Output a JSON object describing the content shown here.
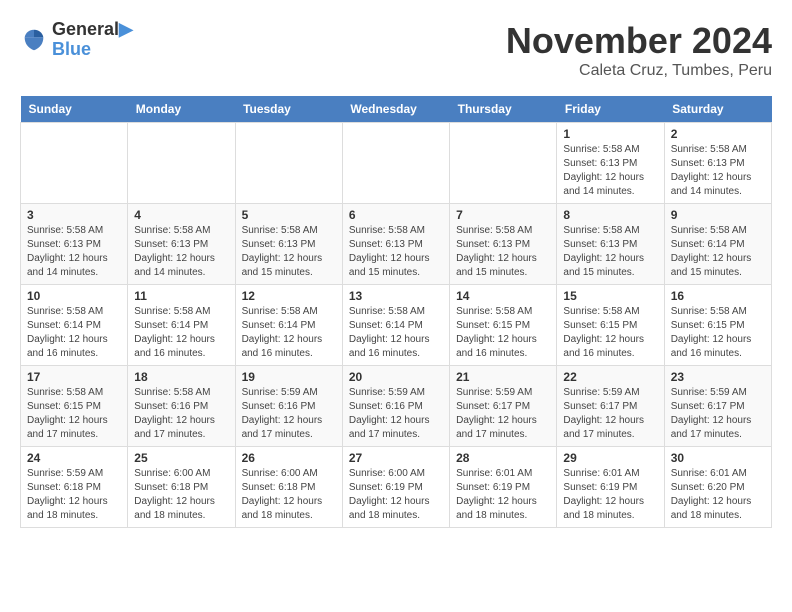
{
  "header": {
    "logo_line1": "General",
    "logo_line2": "Blue",
    "month": "November 2024",
    "location": "Caleta Cruz, Tumbes, Peru"
  },
  "weekdays": [
    "Sunday",
    "Monday",
    "Tuesday",
    "Wednesday",
    "Thursday",
    "Friday",
    "Saturday"
  ],
  "weeks": [
    [
      {
        "day": "",
        "info": ""
      },
      {
        "day": "",
        "info": ""
      },
      {
        "day": "",
        "info": ""
      },
      {
        "day": "",
        "info": ""
      },
      {
        "day": "",
        "info": ""
      },
      {
        "day": "1",
        "info": "Sunrise: 5:58 AM\nSunset: 6:13 PM\nDaylight: 12 hours and 14 minutes."
      },
      {
        "day": "2",
        "info": "Sunrise: 5:58 AM\nSunset: 6:13 PM\nDaylight: 12 hours and 14 minutes."
      }
    ],
    [
      {
        "day": "3",
        "info": "Sunrise: 5:58 AM\nSunset: 6:13 PM\nDaylight: 12 hours and 14 minutes."
      },
      {
        "day": "4",
        "info": "Sunrise: 5:58 AM\nSunset: 6:13 PM\nDaylight: 12 hours and 14 minutes."
      },
      {
        "day": "5",
        "info": "Sunrise: 5:58 AM\nSunset: 6:13 PM\nDaylight: 12 hours and 15 minutes."
      },
      {
        "day": "6",
        "info": "Sunrise: 5:58 AM\nSunset: 6:13 PM\nDaylight: 12 hours and 15 minutes."
      },
      {
        "day": "7",
        "info": "Sunrise: 5:58 AM\nSunset: 6:13 PM\nDaylight: 12 hours and 15 minutes."
      },
      {
        "day": "8",
        "info": "Sunrise: 5:58 AM\nSunset: 6:13 PM\nDaylight: 12 hours and 15 minutes."
      },
      {
        "day": "9",
        "info": "Sunrise: 5:58 AM\nSunset: 6:14 PM\nDaylight: 12 hours and 15 minutes."
      }
    ],
    [
      {
        "day": "10",
        "info": "Sunrise: 5:58 AM\nSunset: 6:14 PM\nDaylight: 12 hours and 16 minutes."
      },
      {
        "day": "11",
        "info": "Sunrise: 5:58 AM\nSunset: 6:14 PM\nDaylight: 12 hours and 16 minutes."
      },
      {
        "day": "12",
        "info": "Sunrise: 5:58 AM\nSunset: 6:14 PM\nDaylight: 12 hours and 16 minutes."
      },
      {
        "day": "13",
        "info": "Sunrise: 5:58 AM\nSunset: 6:14 PM\nDaylight: 12 hours and 16 minutes."
      },
      {
        "day": "14",
        "info": "Sunrise: 5:58 AM\nSunset: 6:15 PM\nDaylight: 12 hours and 16 minutes."
      },
      {
        "day": "15",
        "info": "Sunrise: 5:58 AM\nSunset: 6:15 PM\nDaylight: 12 hours and 16 minutes."
      },
      {
        "day": "16",
        "info": "Sunrise: 5:58 AM\nSunset: 6:15 PM\nDaylight: 12 hours and 16 minutes."
      }
    ],
    [
      {
        "day": "17",
        "info": "Sunrise: 5:58 AM\nSunset: 6:15 PM\nDaylight: 12 hours and 17 minutes."
      },
      {
        "day": "18",
        "info": "Sunrise: 5:58 AM\nSunset: 6:16 PM\nDaylight: 12 hours and 17 minutes."
      },
      {
        "day": "19",
        "info": "Sunrise: 5:59 AM\nSunset: 6:16 PM\nDaylight: 12 hours and 17 minutes."
      },
      {
        "day": "20",
        "info": "Sunrise: 5:59 AM\nSunset: 6:16 PM\nDaylight: 12 hours and 17 minutes."
      },
      {
        "day": "21",
        "info": "Sunrise: 5:59 AM\nSunset: 6:17 PM\nDaylight: 12 hours and 17 minutes."
      },
      {
        "day": "22",
        "info": "Sunrise: 5:59 AM\nSunset: 6:17 PM\nDaylight: 12 hours and 17 minutes."
      },
      {
        "day": "23",
        "info": "Sunrise: 5:59 AM\nSunset: 6:17 PM\nDaylight: 12 hours and 17 minutes."
      }
    ],
    [
      {
        "day": "24",
        "info": "Sunrise: 5:59 AM\nSunset: 6:18 PM\nDaylight: 12 hours and 18 minutes."
      },
      {
        "day": "25",
        "info": "Sunrise: 6:00 AM\nSunset: 6:18 PM\nDaylight: 12 hours and 18 minutes."
      },
      {
        "day": "26",
        "info": "Sunrise: 6:00 AM\nSunset: 6:18 PM\nDaylight: 12 hours and 18 minutes."
      },
      {
        "day": "27",
        "info": "Sunrise: 6:00 AM\nSunset: 6:19 PM\nDaylight: 12 hours and 18 minutes."
      },
      {
        "day": "28",
        "info": "Sunrise: 6:01 AM\nSunset: 6:19 PM\nDaylight: 12 hours and 18 minutes."
      },
      {
        "day": "29",
        "info": "Sunrise: 6:01 AM\nSunset: 6:19 PM\nDaylight: 12 hours and 18 minutes."
      },
      {
        "day": "30",
        "info": "Sunrise: 6:01 AM\nSunset: 6:20 PM\nDaylight: 12 hours and 18 minutes."
      }
    ]
  ]
}
